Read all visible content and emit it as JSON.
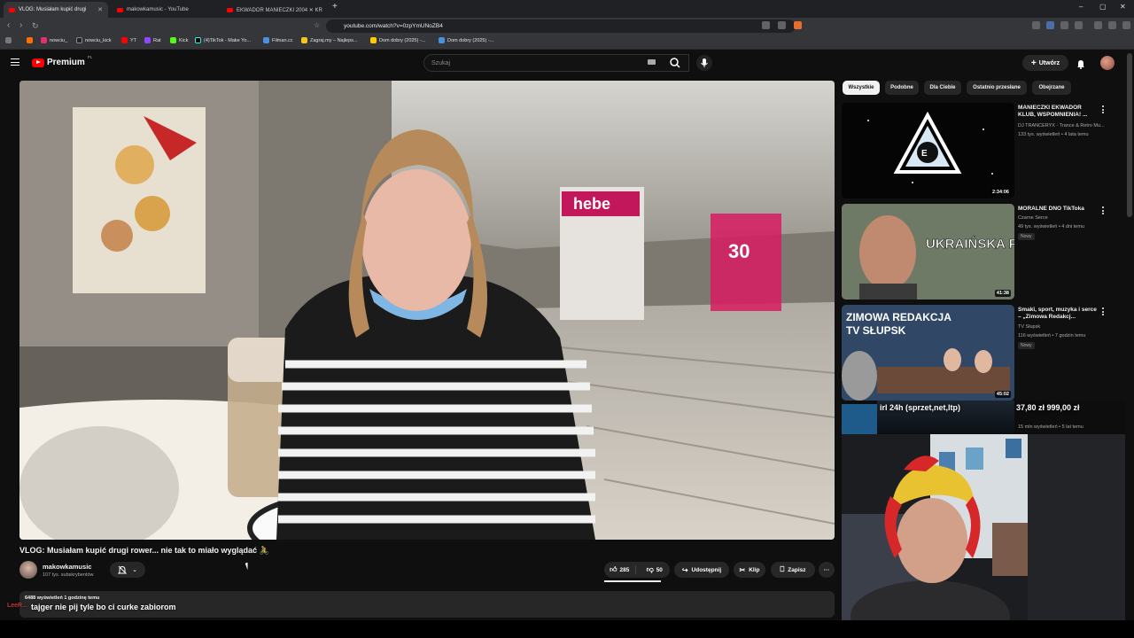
{
  "browser": {
    "tabs": [
      {
        "title": "VLOG: Musiałam kupić drugi",
        "active": true
      },
      {
        "title": "makowkamusic - YouTube",
        "active": false
      },
      {
        "title": "EKWADOR MANIECZKI 2004 ✕ KR",
        "active": false
      }
    ],
    "new_tab": "+",
    "url": "youtube.com/watch?v=0zpYmUNoZB4",
    "bookmarks": [
      "nowciu_",
      "nowciu_kick",
      "YT",
      "Rat",
      "Kick",
      "(4)TikTok - Make Yo...",
      "Filman.cc",
      "Zagraj.my – Najleps...",
      "Dom dobry (2025) -...",
      "Dom dobry (2025) -..."
    ]
  },
  "youtube": {
    "logo_text": "Premium",
    "logo_region": "PL",
    "search_placeholder": "Szukaj",
    "create_label": "Utwórz"
  },
  "video": {
    "title": "VLOG: Musiałam kupić drugi rower... nie tak to miało wyglądać 🚴",
    "channel_name": "makowkamusic",
    "subscribers": "107 tys. subskrybentów",
    "likes": "285",
    "dislikes": "50",
    "share_label": "Udostępnij",
    "clip_label": "Klip",
    "save_label": "Zapisz",
    "description_meta": "6488 wyświetleń  1 godzinę temu"
  },
  "chat_overlay": {
    "user": "LeeR...",
    "message": "tajger nie pij tyle bo ci curke zabiorom"
  },
  "chips": [
    "Wszystkie",
    "Podobne",
    "Dla Ciebie",
    "Ostatnio przesłane",
    "Obejrzane"
  ],
  "recommendations": [
    {
      "title": "MANIECZKI EKWADOR KLUB, WSPOMNIENIA! ...",
      "channel": "DJ TRANCERYX - Trance & Retro Mu...",
      "meta": "133 tys. wyświetleń • 4 lata temu",
      "duration": "2:34:06",
      "badge": ""
    },
    {
      "title": "MORALNE DNO TikToka",
      "channel": "Czarne Serce",
      "meta": "49 tys. wyświetleń • 4 dni temu",
      "duration": "41:38",
      "badge": "Nowy",
      "thumb_text": "UKRAIŃSKA PATOLOGIA"
    },
    {
      "title": "Smaki, sport, muzyka i serce – „Zimowa Redakcj...",
      "channel": "TV Słupsk",
      "meta": "116 wyświetleń • 7 godzin temu",
      "duration": "45:02",
      "badge": "Nowy",
      "thumb_text_1": "ZIMOWA REDAKCJA",
      "thumb_text_2": "TV SŁUPSK"
    }
  ],
  "stream_overlay": {
    "label": "irl 24h (sprzet,net,ltp)",
    "values": "37,80 zł  999,00 zł",
    "meta": "15 mln wyświetleń • 5 lat temu"
  },
  "colors": {
    "background": "#0f0f0f",
    "brand": "#ff0000",
    "chip_selected": "#f1f1f1"
  }
}
